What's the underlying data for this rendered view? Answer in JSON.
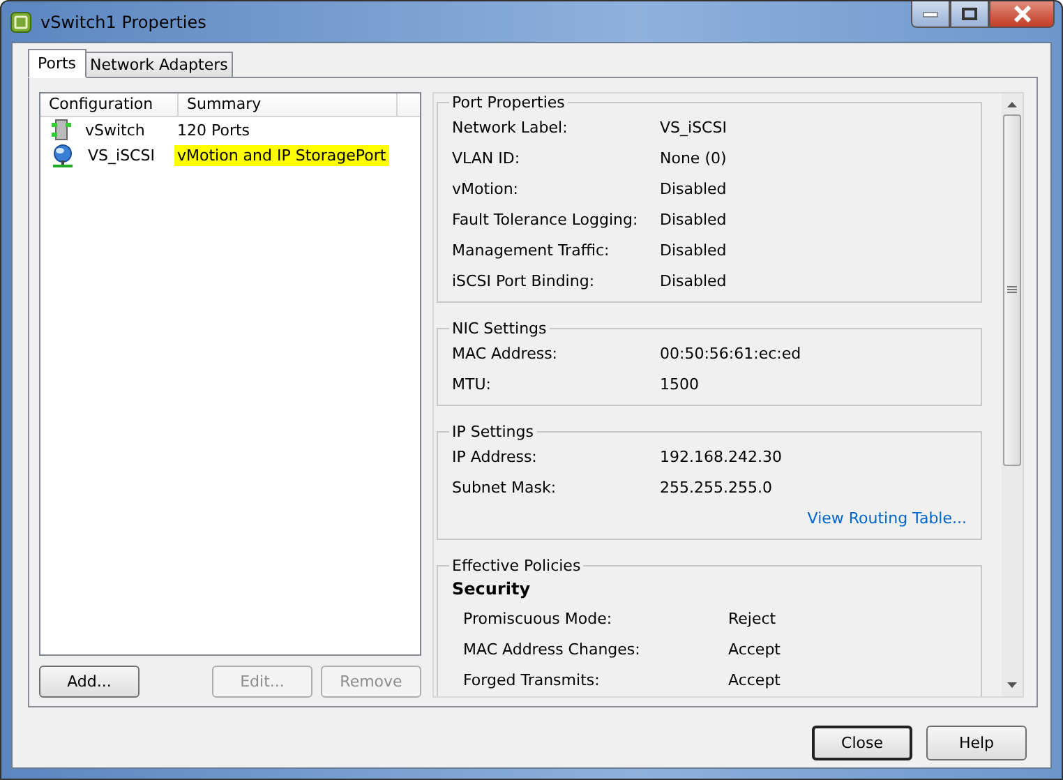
{
  "window": {
    "title": "vSwitch1 Properties"
  },
  "tabs": [
    {
      "label": "Ports",
      "selected": true
    },
    {
      "label": "Network Adapters",
      "selected": false
    }
  ],
  "port_list": {
    "columns": [
      "Configuration",
      "Summary"
    ],
    "rows": [
      {
        "kind": "switch",
        "configuration": "vSwitch",
        "summary": "120 Ports",
        "highlighted": false
      },
      {
        "kind": "port",
        "configuration": "VS_iSCSI",
        "summary": "vMotion and IP StoragePort",
        "highlighted": true
      }
    ]
  },
  "list_buttons": [
    {
      "label": "Add...",
      "disabled": false
    },
    {
      "label": "Edit...",
      "disabled": true
    },
    {
      "label": "Remove",
      "disabled": true
    }
  ],
  "sections": [
    {
      "title": "Port Properties",
      "rows": [
        {
          "label": "Network Label:",
          "value": "VS_iSCSI"
        },
        {
          "label": "VLAN ID:",
          "value": "None (0)"
        },
        {
          "label": "vMotion:",
          "value": "Disabled"
        },
        {
          "label": "Fault Tolerance Logging:",
          "value": "Disabled"
        },
        {
          "label": "Management Traffic:",
          "value": "Disabled"
        },
        {
          "label": "iSCSI Port Binding:",
          "value": "Disabled"
        }
      ]
    },
    {
      "title": "NIC Settings",
      "rows": [
        {
          "label": "MAC Address:",
          "value": "00:50:56:61:ec:ed"
        },
        {
          "label": "MTU:",
          "value": "1500"
        }
      ]
    },
    {
      "title": "IP Settings",
      "rows": [
        {
          "label": "IP Address:",
          "value": "192.168.242.30"
        },
        {
          "label": "Subnet Mask:",
          "value": "255.255.255.0"
        }
      ],
      "link": "View Routing Table..."
    },
    {
      "title": "Effective Policies",
      "subheading": "Security",
      "rows": [
        {
          "label": "Promiscuous Mode:",
          "value": "Reject"
        },
        {
          "label": "MAC Address Changes:",
          "value": "Accept"
        },
        {
          "label": "Forged Transmits:",
          "value": "Accept"
        }
      ]
    }
  ],
  "dialog_buttons": [
    {
      "label": "Close",
      "default": true
    },
    {
      "label": "Help",
      "default": false
    }
  ]
}
